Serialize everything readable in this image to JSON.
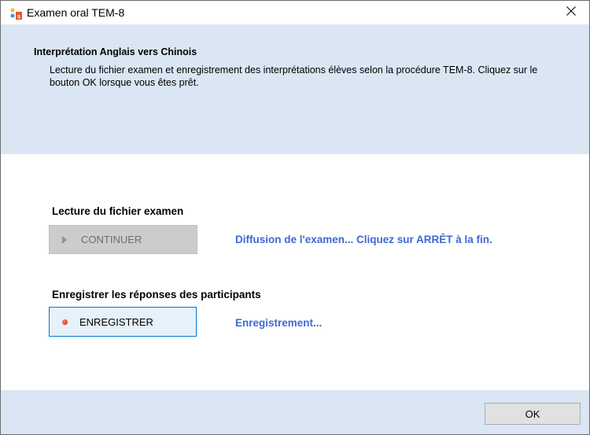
{
  "window": {
    "title": "Examen oral TEM-8",
    "close_glyph": "✕"
  },
  "header": {
    "title": "Interprétation Anglais vers Chinois",
    "description": "Lecture du fichier examen et enregistrement des interprétations élèves selon la procédure TEM-8. Cliquez sur le bouton OK lorsque vous êtes prêt."
  },
  "playback": {
    "label": "Lecture du fichier examen",
    "button_label": "CONTINUER",
    "button_icon": "play-icon",
    "status": "Diffusion de l'examen... Cliquez sur ARRÊT à la fin."
  },
  "recording": {
    "label": "Enregistrer les réponses des participants",
    "button_label": "ENREGISTRER",
    "button_icon": "record-icon",
    "status": "Enregistrement..."
  },
  "footer": {
    "ok_label": "OK"
  },
  "colors": {
    "panel_bg": "#dae6f3",
    "status_text": "#3b69d6",
    "focus_border": "#0078d7"
  }
}
